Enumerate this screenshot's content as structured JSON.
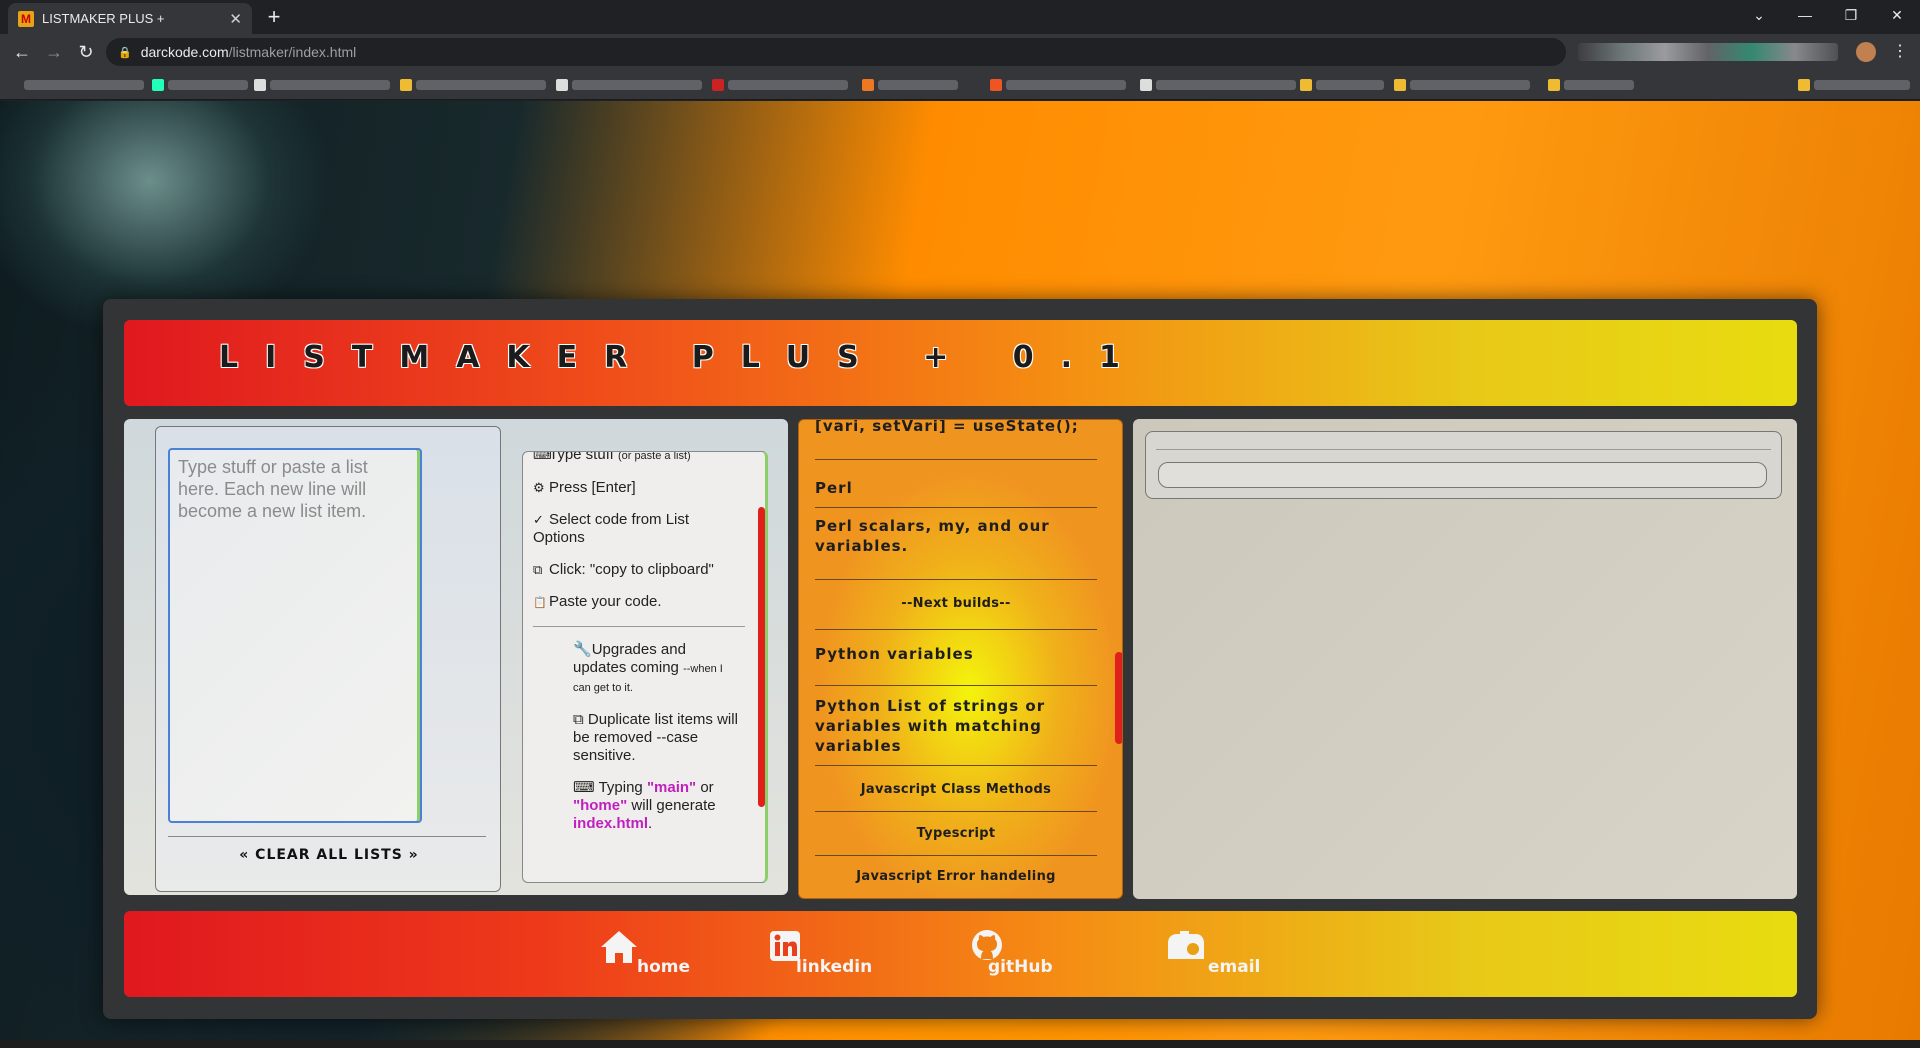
{
  "browser": {
    "tab_title": "LISTMAKER PLUS +",
    "tab_close": "✕",
    "new_tab": "+",
    "url_host": "darckode.com",
    "url_path": "/listmaker/index.html"
  },
  "app": {
    "title": "LISTMAKER PLUS + 0.1"
  },
  "input": {
    "placeholder": "Type stuff or paste a list here. Each new line will become a new list item.",
    "value": "",
    "clear_label": "« CLEAR ALL LISTS »"
  },
  "help": {
    "steps": [
      {
        "icon": "keyboard-icon",
        "glyph": "⌨",
        "text": "Type stuff",
        "small": "(or paste a list)"
      },
      {
        "icon": "gear-icon",
        "glyph": "⚙",
        "text": "Press [Enter]",
        "small": ""
      },
      {
        "icon": "check-icon",
        "glyph": "✓",
        "text": "Select code from List Options",
        "small": ""
      },
      {
        "icon": "copy-icon",
        "glyph": "⧉",
        "text": "Click: \"copy to clipboard\"",
        "small": ""
      },
      {
        "icon": "paste-icon",
        "glyph": "📋",
        "text": "Paste your code.",
        "small": ""
      }
    ],
    "notes": {
      "upgrades": "Upgrades and updates coming",
      "upgrades_small": "--when I can get to it.",
      "duplicates": "Duplicate list items will be removed --case sensitive.",
      "typing_prefix": "Typing ",
      "kw_main": "\"main\"",
      "or": " or ",
      "kw_home": "\"home\"",
      "will_generate": " will generate ",
      "kw_index": "index.html",
      "period": "."
    }
  },
  "list_options": {
    "items": [
      "[vari, setVari] = useState();",
      "Perl",
      "Perl scalars, my, and our variables.",
      "--Next builds--",
      "Python variables",
      "Python List of strings or variables with matching variables",
      "Javascript Class Methods",
      "Typescript",
      "Javascript Error handeling"
    ]
  },
  "footer": {
    "links": [
      {
        "label": "home",
        "icon": "home-icon"
      },
      {
        "label": "linkedin",
        "icon": "linkedin-icon"
      },
      {
        "label": "gitHub",
        "icon": "github-icon"
      },
      {
        "label": "email",
        "icon": "mailbox-icon"
      }
    ]
  },
  "colors": {
    "accent_red": "#e0181f",
    "accent_yellow": "#e8dc10",
    "keyword_magenta": "#c020c0",
    "scrollbar_red": "#e0201a"
  }
}
